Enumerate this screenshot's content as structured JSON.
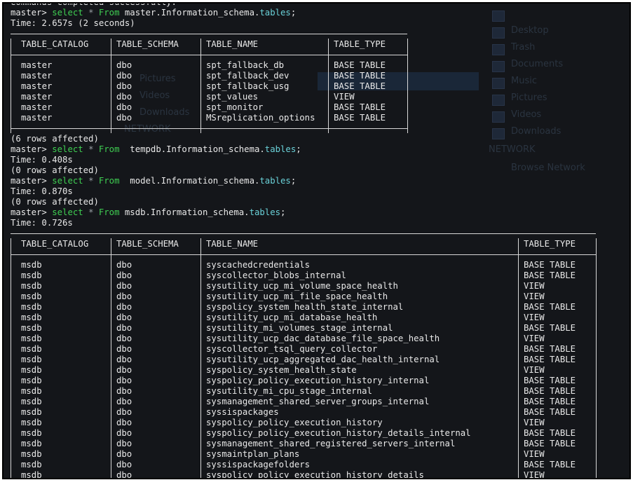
{
  "terminal": {
    "lines": [
      {
        "type": "text",
        "text": "Commands completed successfully."
      },
      {
        "type": "cmd",
        "prompt": "master>",
        "select": "select",
        "star": "*",
        "from": "From",
        "db": " master.Information_schema.",
        "tbl": "tables",
        "end": ";"
      },
      {
        "type": "text",
        "text": "Time: 2.657s (2 seconds)"
      }
    ],
    "between1": [
      {
        "type": "text",
        "text": "(6 rows affected)"
      },
      {
        "type": "cmd",
        "prompt": "master>",
        "select": "select",
        "star": "*",
        "from": "From",
        "db": "  tempdb.Information_schema.",
        "tbl": "tables",
        "end": ";"
      },
      {
        "type": "text",
        "text": "Time: 0.408s"
      },
      {
        "type": "text",
        "text": "(0 rows affected)"
      },
      {
        "type": "cmd",
        "prompt": "master>",
        "select": "select",
        "star": "*",
        "from": "From",
        "db": "  model.Information_schema.",
        "tbl": "tables",
        "end": ";"
      },
      {
        "type": "text",
        "text": "Time: 0.870s"
      },
      {
        "type": "text",
        "text": "(0 rows affected)"
      },
      {
        "type": "cmd",
        "prompt": "master>",
        "select": "select",
        "star": "*",
        "from": "From",
        "db": " msdb.Information_schema.",
        "tbl": "tables",
        "end": ";"
      },
      {
        "type": "text",
        "text": "Time: 0.726s"
      }
    ]
  },
  "table1": {
    "headers": [
      "TABLE_CATALOG",
      "TABLE_SCHEMA",
      "TABLE_NAME",
      "TABLE_TYPE"
    ],
    "rows": [
      [
        "master",
        "dbo",
        "spt_fallback_db",
        "BASE TABLE"
      ],
      [
        "master",
        "dbo",
        "spt_fallback_dev",
        "BASE TABLE"
      ],
      [
        "master",
        "dbo",
        "spt_fallback_usg",
        "BASE TABLE"
      ],
      [
        "master",
        "dbo",
        "spt_values",
        "VIEW"
      ],
      [
        "master",
        "dbo",
        "spt_monitor",
        "BASE TABLE"
      ],
      [
        "master",
        "dbo",
        "MSreplication_options",
        "BASE TABLE"
      ]
    ]
  },
  "table2": {
    "headers": [
      "TABLE_CATALOG",
      "TABLE_SCHEMA",
      "TABLE_NAME",
      "TABLE_TYPE"
    ],
    "rows": [
      [
        "msdb",
        "dbo",
        "syscachedcredentials",
        "BASE TABLE"
      ],
      [
        "msdb",
        "dbo",
        "syscollector_blobs_internal",
        "BASE TABLE"
      ],
      [
        "msdb",
        "dbo",
        "sysutility_ucp_mi_volume_space_health",
        "VIEW"
      ],
      [
        "msdb",
        "dbo",
        "sysutility_ucp_mi_file_space_health",
        "VIEW"
      ],
      [
        "msdb",
        "dbo",
        "syspolicy_system_health_state_internal",
        "BASE TABLE"
      ],
      [
        "msdb",
        "dbo",
        "sysutility_ucp_mi_database_health",
        "VIEW"
      ],
      [
        "msdb",
        "dbo",
        "sysutility_mi_volumes_stage_internal",
        "BASE TABLE"
      ],
      [
        "msdb",
        "dbo",
        "sysutility_ucp_dac_database_file_space_health",
        "VIEW"
      ],
      [
        "msdb",
        "dbo",
        "syscollector_tsql_query_collector",
        "BASE TABLE"
      ],
      [
        "msdb",
        "dbo",
        "sysutility_ucp_aggregated_dac_health_internal",
        "BASE TABLE"
      ],
      [
        "msdb",
        "dbo",
        "syspolicy_system_health_state",
        "VIEW"
      ],
      [
        "msdb",
        "dbo",
        "syspolicy_policy_execution_history_internal",
        "BASE TABLE"
      ],
      [
        "msdb",
        "dbo",
        "sysutility_mi_cpu_stage_internal",
        "BASE TABLE"
      ],
      [
        "msdb",
        "dbo",
        "sysmanagement_shared_server_groups_internal",
        "BASE TABLE"
      ],
      [
        "msdb",
        "dbo",
        "syssispackages",
        "BASE TABLE"
      ],
      [
        "msdb",
        "dbo",
        "syspolicy_policy_execution_history",
        "VIEW"
      ],
      [
        "msdb",
        "dbo",
        "syspolicy_policy_execution_history_details_internal",
        "BASE TABLE"
      ],
      [
        "msdb",
        "dbo",
        "sysmanagement_shared_registered_servers_internal",
        "BASE TABLE"
      ],
      [
        "msdb",
        "dbo",
        "sysmaintplan_plans",
        "VIEW"
      ],
      [
        "msdb",
        "dbo",
        "syssispackagefolders",
        "BASE TABLE"
      ],
      [
        "msdb",
        "dbo",
        "syspolicy_policy_execution_history_details",
        "VIEW"
      ]
    ]
  },
  "background": {
    "labels": [
      "Desktop",
      "Trash",
      "Documents",
      "Music",
      "Pictures",
      "Videos",
      "Downloads",
      "NETWORK",
      "Browse Network",
      "Pictures",
      "Videos",
      "Downloads",
      "NETWORK"
    ]
  }
}
